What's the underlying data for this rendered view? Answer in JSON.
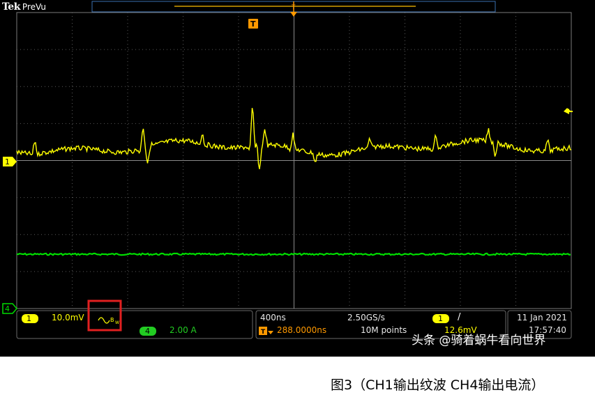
{
  "brand": {
    "logo": "Tek",
    "mode": "PreVu"
  },
  "trigger": {
    "top_marker": "T"
  },
  "ch1": {
    "badge": "1",
    "scale": "10.0mV",
    "coupling_icon": "bandwidth-limit-icon",
    "color": "#ffff00"
  },
  "ch4": {
    "badge": "4",
    "scale": "2.00 A",
    "color": "#00dd00"
  },
  "horizontal": {
    "timebase": "400ns",
    "sample_rate": "2.50GS/s",
    "delay": "288.0000ns",
    "record": "10M points"
  },
  "trigger_panel": {
    "source": "1",
    "slope": "/",
    "level": "12.6mV"
  },
  "datetime": {
    "date": "11 Jan  2021",
    "time": "17:57:40"
  },
  "watermark": "头条 @骑着蜗牛看向世界",
  "caption": "图3（CH1输出纹波 CH4输出电流）",
  "highlight_color": "#e02020"
}
